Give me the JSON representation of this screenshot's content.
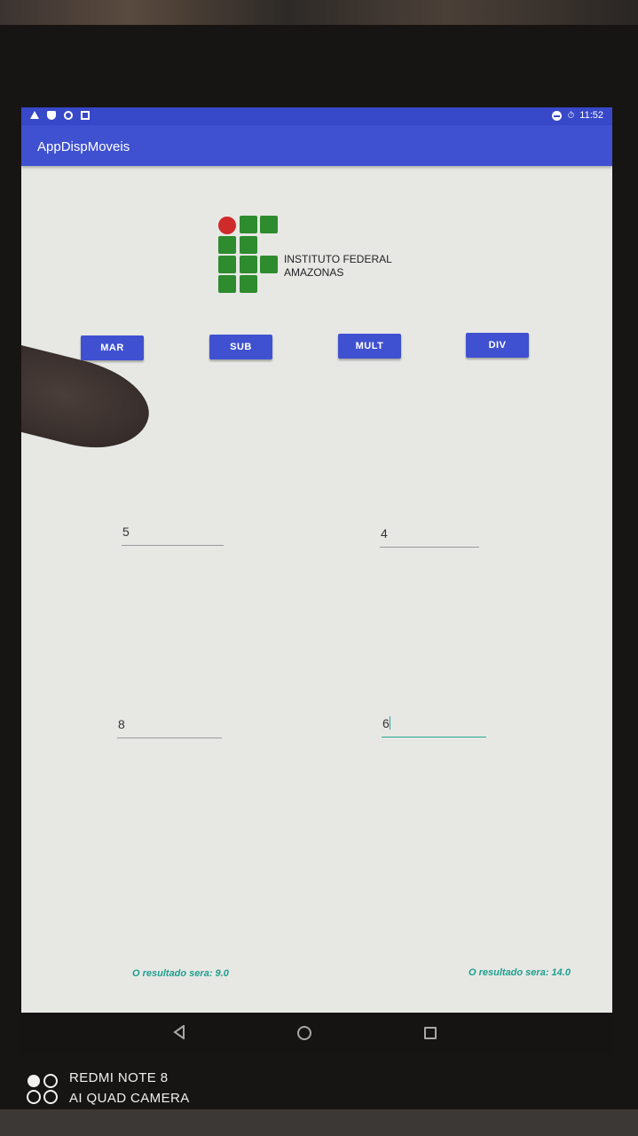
{
  "status_bar": {
    "time": "11:52",
    "left_icons": [
      "warning-icon",
      "shield-icon",
      "target-icon",
      "notification-box-icon"
    ],
    "right_icons": [
      "do-not-disturb-icon",
      "alarm-icon"
    ]
  },
  "app_bar": {
    "title": "AppDispMoveis"
  },
  "logo": {
    "line1": "INSTITUTO FEDERAL",
    "line2": "AMAZONAS"
  },
  "buttons": {
    "sum": "MAR",
    "sub": "SUB",
    "mult": "MULT",
    "div": "DIV"
  },
  "inputs": {
    "top_left": "5",
    "top_right": "4",
    "bottom_left": "8",
    "bottom_right": "6"
  },
  "results": {
    "left": "O resultado sera: 9.0",
    "right": "O resultado sera: 14.0"
  },
  "nav": {
    "icons": [
      "back-icon",
      "home-icon",
      "recents-icon"
    ]
  },
  "watermark": {
    "line1": "REDMI NOTE 8",
    "line2": "AI QUAD CAMERA"
  },
  "colors": {
    "primary": "#3f51d0",
    "accent": "#1f9e8f",
    "logo_green": "#2e8b2e",
    "logo_red": "#cf2b2b"
  }
}
